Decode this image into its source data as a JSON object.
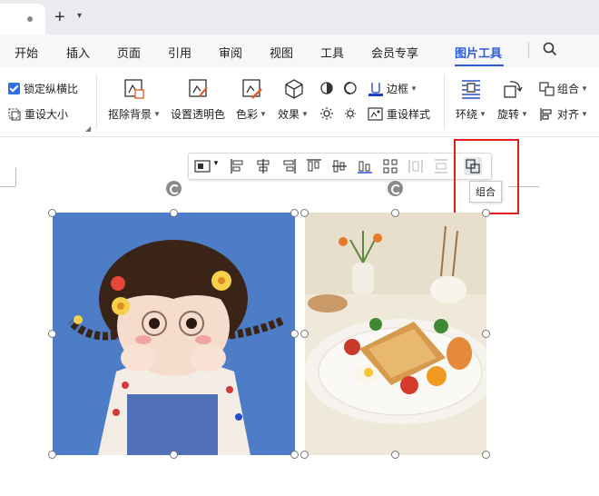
{
  "tabs": {
    "new_tab": "+"
  },
  "menu": [
    "开始",
    "插入",
    "页面",
    "引用",
    "审阅",
    "视图",
    "工具",
    "会员专享",
    "图片工具"
  ],
  "ribbon": {
    "lock_ratio": "锁定纵横比",
    "reset_size": "重设大小",
    "remove_bg": "抠除背景",
    "set_transparent": "设置透明色",
    "color": "色彩",
    "effects": "效果",
    "border": "边框",
    "reset_style": "重设样式",
    "wrap": "环绕",
    "rotate": "旋转",
    "group": "组合",
    "align": "对齐"
  },
  "tooltip": "组合",
  "colors": {
    "accent": "#2f5bd8",
    "highlight": "#e02020"
  }
}
